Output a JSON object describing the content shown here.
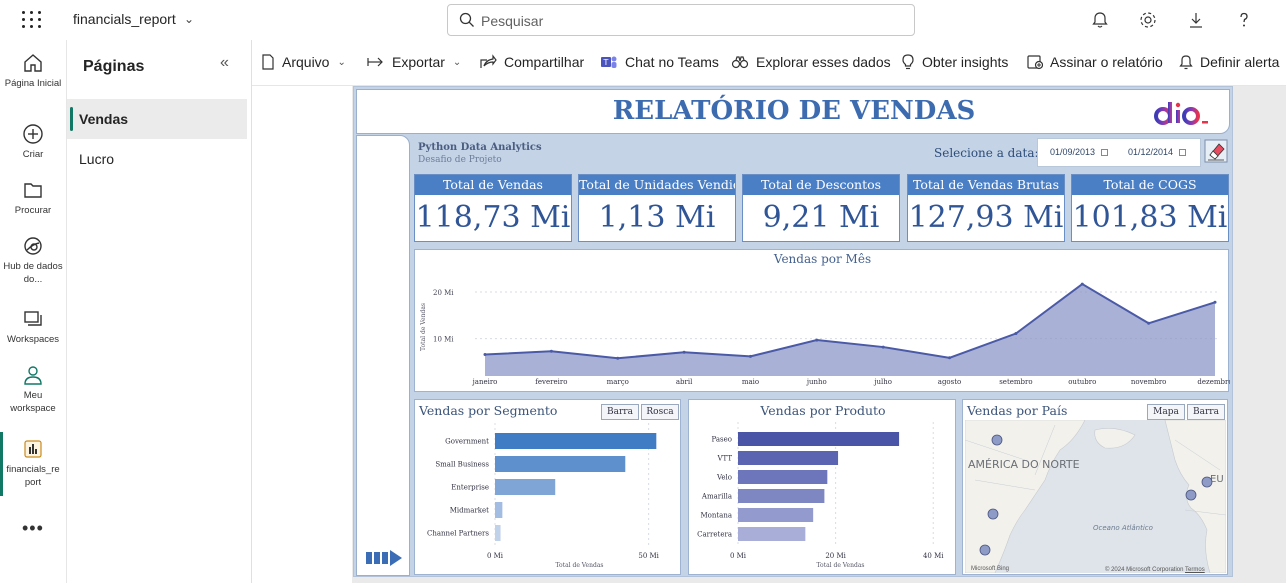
{
  "app": {
    "title": "financials_report"
  },
  "search": {
    "placeholder": "Pesquisar"
  },
  "rail": {
    "items": [
      {
        "label": "Página Inicial"
      },
      {
        "label": "Criar"
      },
      {
        "label": "Procurar"
      },
      {
        "label": "Hub de dados do..."
      },
      {
        "label": "Workspaces"
      },
      {
        "label": "Meu workspace"
      },
      {
        "label": "financials_re port"
      }
    ],
    "more": "•••"
  },
  "pages": {
    "title": "Páginas",
    "items": [
      {
        "label": "Vendas"
      },
      {
        "label": "Lucro"
      }
    ]
  },
  "commands": {
    "arquivo": "Arquivo",
    "exportar": "Exportar",
    "compartilhar": "Compartilhar",
    "chat_teams": "Chat no Teams",
    "explorar": "Explorar esses dados",
    "insights": "Obter insights",
    "assinar": "Assinar o relatório",
    "alerta": "Definir alerta"
  },
  "report": {
    "title": "RELATÓRIO DE VENDAS",
    "subtitle": "Python Data Analytics",
    "subtitle2": "Desafio de Projeto",
    "date_label": "Selecione a data:",
    "date_start": "01/09/2013",
    "date_end": "01/12/2014",
    "kpis": [
      {
        "label": "Total de Vendas",
        "value": "118,73 Mi"
      },
      {
        "label": "Total de Unidades Vendidas",
        "value": "1,13 Mi"
      },
      {
        "label": "Total de Descontos",
        "value": "9,21 Mi"
      },
      {
        "label": "Total de Vendas Brutas",
        "value": "127,93 Mi"
      },
      {
        "label": "Total de COGS",
        "value": "101,83 Mi"
      }
    ],
    "segment_card": {
      "title": "Vendas por Segmento",
      "btn1": "Barra",
      "btn2": "Rosca"
    },
    "product_card": {
      "title": "Vendas por Produto"
    },
    "country_card": {
      "title": "Vendas por País",
      "btn1": "Mapa",
      "btn2": "Barra"
    },
    "map_labels": {
      "na": "AMÉRICA DO NORTE",
      "eu": "EU",
      "ocean": "Oceano Atlântico",
      "copyright": "© 2024 Microsoft Corporation",
      "terms": "Termos",
      "logo": "Microsoft Bing"
    }
  },
  "chart_data": [
    {
      "type": "area",
      "title": "Vendas por Mês",
      "ylabel": "Total de Vendas",
      "categories": [
        "janeiro",
        "fevereiro",
        "março",
        "abril",
        "maio",
        "junho",
        "julho",
        "agosto",
        "setembro",
        "outubro",
        "novembro",
        "dezembro"
      ],
      "values": [
        6.6,
        7.3,
        5.8,
        7.1,
        6.2,
        9.7,
        8.2,
        5.9,
        11.1,
        21.7,
        13.3,
        17.8
      ],
      "ylim": [
        2,
        23
      ],
      "y_ticks": [
        {
          "v": 10,
          "label": "10 Mi"
        },
        {
          "v": 20,
          "label": "20 Mi"
        }
      ],
      "color": "#8e97c8",
      "line_color": "#4a5aa6"
    },
    {
      "type": "bar",
      "orientation": "horizontal",
      "title": "Vendas por Segmento",
      "xlabel": "Total de Vendas",
      "categories": [
        "Government",
        "Small Business",
        "Enterprise",
        "Midmarket",
        "Channel Partners"
      ],
      "values": [
        52.5,
        42.4,
        19.6,
        2.4,
        1.8
      ],
      "xlim": [
        0,
        55
      ],
      "x_ticks": [
        {
          "v": 0,
          "label": "0 Mi"
        },
        {
          "v": 50,
          "label": "50 Mi"
        }
      ],
      "colors": [
        "#3f7cc4",
        "#5d90cc",
        "#7ea5d6",
        "#a3bde2",
        "#c0d1ea"
      ]
    },
    {
      "type": "bar",
      "orientation": "horizontal",
      "title": "Vendas por Produto",
      "xlabel": "Total de Vendas",
      "categories": [
        "Paseo",
        "VTT",
        "Velo",
        "Amarilla",
        "Montana",
        "Carretera"
      ],
      "values": [
        33.0,
        20.5,
        18.3,
        17.7,
        15.4,
        13.8
      ],
      "xlim": [
        0,
        42
      ],
      "x_ticks": [
        {
          "v": 0,
          "label": "0 Mi"
        },
        {
          "v": 20,
          "label": "20 Mi"
        },
        {
          "v": 40,
          "label": "40 Mi"
        }
      ],
      "colors": [
        "#4a55a8",
        "#5a64b0",
        "#6d76ba",
        "#7f87c3",
        "#939acd",
        "#a8aed8"
      ]
    }
  ]
}
